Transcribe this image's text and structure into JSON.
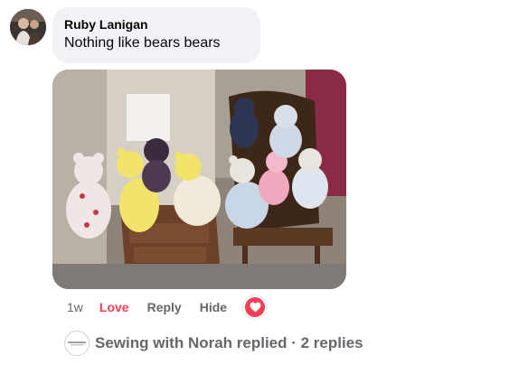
{
  "comment": {
    "author": "Ruby Lanigan",
    "text": "Nothing like bears bears",
    "image_alt": "teddy-bears-photo"
  },
  "actions": {
    "time": "1w",
    "love_label": "Love",
    "reply_label": "Reply",
    "hide_label": "Hide",
    "reaction_icon": "heart-icon",
    "reaction_color": "#f33e58"
  },
  "replies": {
    "summary": "Sewing with Norah replied · 2 replies"
  }
}
